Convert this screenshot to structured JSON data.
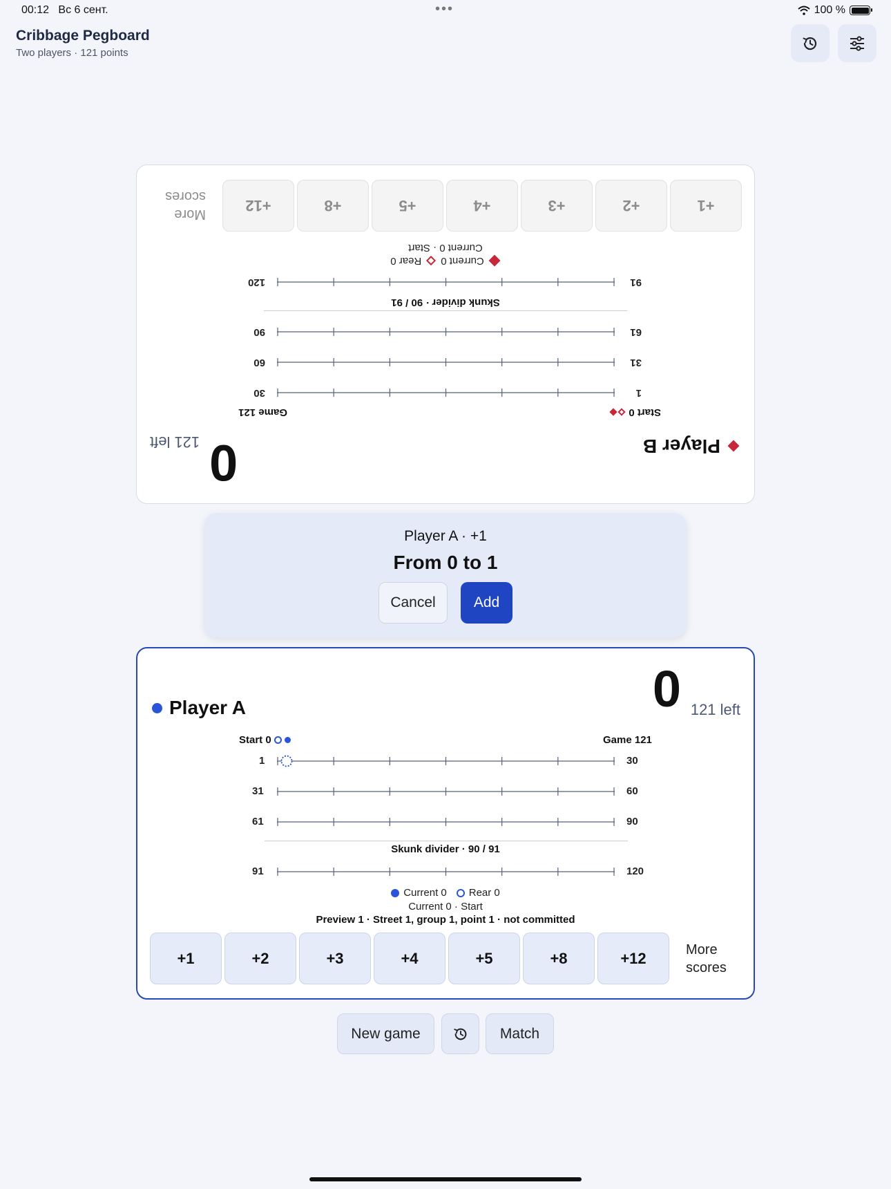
{
  "status": {
    "time": "00:12",
    "date": "Вс 6 сент.",
    "battery": "100 %"
  },
  "header": {
    "title": "Cribbage Pegboard",
    "subtitle": "Two players · 121 points"
  },
  "player_b": {
    "name": "Player B",
    "score": "0",
    "left": "121 left",
    "start": "Start 0",
    "game": "Game 121",
    "rows": [
      [
        "1",
        "30"
      ],
      [
        "31",
        "60"
      ],
      [
        "61",
        "90"
      ],
      [
        "91",
        "120"
      ]
    ],
    "skunk": "Skunk divider · 90 / 91",
    "legend_current": "Current 0",
    "legend_rear": "Rear 0",
    "sub": "Current 0 · Start",
    "buttons": [
      "+1",
      "+2",
      "+3",
      "+4",
      "+5",
      "+8",
      "+12"
    ],
    "more_line1": "More",
    "more_line2": "scores"
  },
  "confirm": {
    "title": "Player A · +1",
    "main": "From 0 to 1",
    "cancel": "Cancel",
    "add": "Add"
  },
  "player_a": {
    "name": "Player A",
    "score": "0",
    "left": "121 left",
    "start": "Start 0",
    "game": "Game 121",
    "rows": [
      [
        "1",
        "30"
      ],
      [
        "31",
        "60"
      ],
      [
        "61",
        "90"
      ],
      [
        "91",
        "120"
      ]
    ],
    "skunk": "Skunk divider · 90 / 91",
    "legend_current": "Current 0",
    "legend_rear": "Rear 0",
    "sub": "Current 0 · Start",
    "preview": "Preview 1 · Street 1, group 1, point 1 · not committed",
    "buttons": [
      "+1",
      "+2",
      "+3",
      "+4",
      "+5",
      "+8",
      "+12"
    ],
    "more_line1": "More",
    "more_line2": "scores"
  },
  "footer": {
    "new_game": "New game",
    "match": "Match"
  },
  "colors": {
    "accent": "#2045c3",
    "player_a": "#2a55d6",
    "player_b": "#c6283a"
  }
}
